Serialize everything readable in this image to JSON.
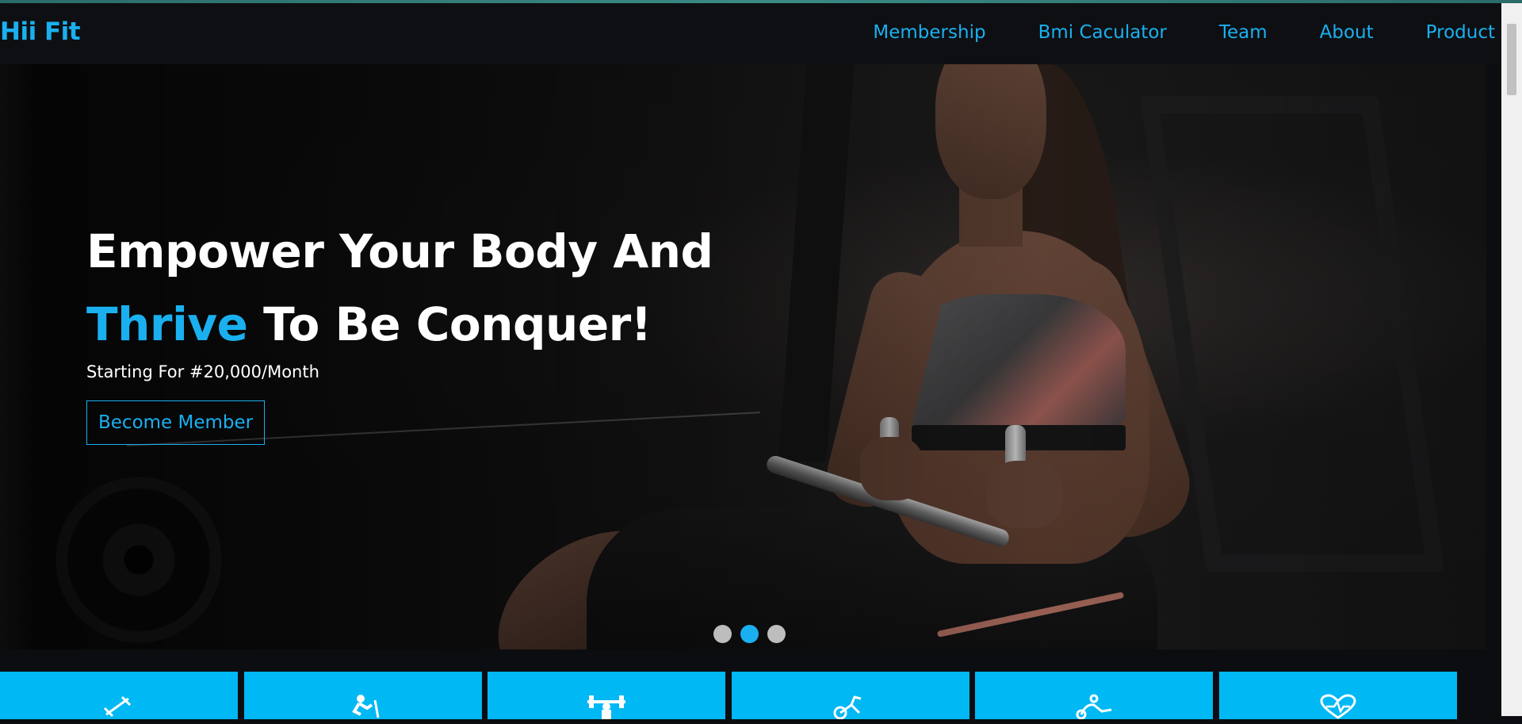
{
  "brand": {
    "name": "Hii Fit"
  },
  "nav": {
    "items": [
      {
        "label": "Membership"
      },
      {
        "label": "Bmi Caculator"
      },
      {
        "label": "Team"
      },
      {
        "label": "About"
      },
      {
        "label": "Product"
      }
    ]
  },
  "hero": {
    "line1": "Empower Your Body And",
    "line2_accent": "Thrive",
    "line2_rest": " To Be Conquer!",
    "subtitle": "Starting For #20,000/Month",
    "cta_label": "Become Member",
    "slides": {
      "count": 3,
      "active_index": 1
    }
  },
  "features": {
    "icons": [
      "dumbbell-icon",
      "treadmill-icon",
      "weightlifting-icon",
      "exercise-bike-icon",
      "cycling-icon",
      "heartbeat-icon"
    ]
  },
  "colors": {
    "accent": "#1ab0f0",
    "feature_bg": "#00b8f4",
    "nav_bg": "#0e0f12"
  }
}
